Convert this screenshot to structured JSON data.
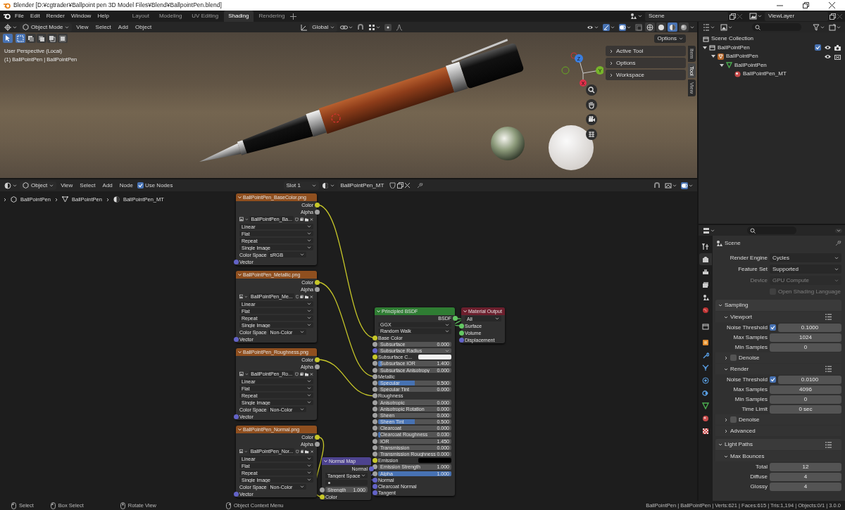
{
  "window": {
    "title": "Blender [D:¥cgtrader¥Ballpoint pen 3D Model Files¥Blend¥BallpointPen.blend]"
  },
  "menu": [
    "File",
    "Edit",
    "Render",
    "Window",
    "Help"
  ],
  "workspaces": [
    {
      "label": "Layout",
      "selected": false
    },
    {
      "label": "Modeling",
      "selected": false
    },
    {
      "label": "UV Editing",
      "selected": false
    },
    {
      "label": "Shading",
      "selected": true
    },
    {
      "label": "Rendering",
      "selected": false
    }
  ],
  "scene": "Scene",
  "view_layer": "ViewLayer",
  "viewport": {
    "mode": "Object Mode",
    "menu": [
      "View",
      "Select",
      "Add",
      "Object"
    ],
    "orientation": "Global",
    "select_modes": [
      {
        "selected": true
      },
      {
        "selected": false
      },
      {
        "selected": false
      },
      {
        "selected": false
      },
      {
        "selected": false
      }
    ],
    "shading_modes": [
      {
        "selected": false
      },
      {
        "selected": false
      },
      {
        "selected": true
      },
      {
        "selected": false
      }
    ],
    "options": "Options",
    "info": [
      "User Perspective (Local)",
      "(1) BallPointPen | BallPointPen"
    ],
    "gizmo_axes": [
      "Z",
      "Y",
      "X"
    ],
    "sidebar_panels": [
      {
        "label": "Active Tool",
        "expanded": false
      },
      {
        "label": "Options",
        "expanded": false
      },
      {
        "label": "Workspace",
        "expanded": false
      }
    ],
    "sidebar_tabs": [
      {
        "label": "Item",
        "selected": false
      },
      {
        "label": "Tool",
        "selected": true
      },
      {
        "label": "View",
        "selected": false
      }
    ]
  },
  "node_editor": {
    "object": "Object",
    "menu": [
      "View",
      "Select",
      "Add",
      "Node"
    ],
    "use_nodes": {
      "label": "Use Nodes",
      "checked": true
    },
    "slot": "Slot 1",
    "material": "BallPointPen_MT",
    "breadcrumbs": [
      "BallPointPen",
      "BallPointPen",
      "BallPointPen_MT"
    ],
    "nodes": [
      {
        "kind": "image",
        "title": "BallPointPen_BaseColor.png",
        "outputs": [
          {
            "label": "Color",
            "socket": {
              "color": "#c7c729"
            }
          },
          {
            "label": "Alpha",
            "socket": {
              "color": "#a1a1a1"
            }
          }
        ],
        "image": "BallPointPen_Ba...",
        "dropdowns": [
          "Linear",
          "Flat",
          "Repeat",
          "Single Image"
        ],
        "color_space": {
          "label": "Color Space",
          "value": "sRGB"
        },
        "inputs": [
          {
            "kind": "socket",
            "label": "Vector",
            "socket": {
              "color": "#6363c7"
            }
          }
        ]
      },
      {
        "kind": "image",
        "title": "BallPointPen_Metallic.png",
        "outputs": [
          {
            "label": "Color",
            "socket": {
              "color": "#c7c729"
            }
          },
          {
            "label": "Alpha",
            "socket": {
              "color": "#a1a1a1"
            }
          }
        ],
        "image": "BallPointPen_Me...",
        "dropdowns": [
          "Linear",
          "Flat",
          "Repeat",
          "Single Image"
        ],
        "color_space": {
          "label": "Color Space",
          "value": "Non-Color"
        },
        "inputs": [
          {
            "kind": "socket",
            "label": "Vector",
            "socket": {
              "color": "#6363c7"
            }
          }
        ]
      },
      {
        "kind": "image",
        "title": "BallPointPen_Roughness.png",
        "outputs": [
          {
            "label": "Color",
            "socket": {
              "color": "#c7c729"
            }
          },
          {
            "label": "Alpha",
            "socket": {
              "color": "#a1a1a1"
            }
          }
        ],
        "image": "BallPointPen_Ro...",
        "dropdowns": [
          "Linear",
          "Flat",
          "Repeat",
          "Single Image"
        ],
        "color_space": {
          "label": "Color Space",
          "value": "Non-Color"
        },
        "inputs": [
          {
            "kind": "socket",
            "label": "Vector",
            "socket": {
              "color": "#6363c7"
            }
          }
        ]
      },
      {
        "kind": "image",
        "title": "BallPointPen_Normal.png",
        "outputs": [
          {
            "label": "Color",
            "socket": {
              "color": "#c7c729"
            }
          },
          {
            "label": "Alpha",
            "socket": {
              "color": "#a1a1a1"
            }
          }
        ],
        "image": "BallPointPen_Nor...",
        "dropdowns": [
          "Linear",
          "Flat",
          "Repeat",
          "Single Image"
        ],
        "color_space": {
          "label": "Color Space",
          "value": "Non-Color"
        },
        "inputs": [
          {
            "kind": "socket",
            "label": "Vector",
            "socket": {
              "color": "#6363c7"
            }
          }
        ]
      },
      {
        "kind": "bsdf",
        "title": "Principled BSDF",
        "outputs": [
          {
            "label": "BSDF",
            "socket": {
              "color": "#63c763"
            }
          }
        ],
        "dropdowns": [
          "GGX",
          "Random Walk"
        ],
        "inputs": [
          {
            "kind": "socket",
            "label": "Base Color",
            "socket": {
              "color": "#c7c729"
            }
          },
          {
            "kind": "slider",
            "label": "Subsurface",
            "value": "0.000",
            "level": 0,
            "socket": {
              "color": "#a1a1a1"
            }
          },
          {
            "kind": "dropdown",
            "label": "Subsurface Radius",
            "socket": {
              "color": "#6363c7"
            }
          },
          {
            "kind": "swatch",
            "label": "Subsurface C...",
            "color": "#f2f2f2",
            "socket": {
              "color": "#c7c729"
            }
          },
          {
            "kind": "slider",
            "label": "Subsurface IOR",
            "value": "1.400",
            "level": 0.05,
            "socket": {
              "color": "#a1a1a1"
            }
          },
          {
            "kind": "slider",
            "label": "Subsurface Anisotropy",
            "value": "0.000",
            "level": 0,
            "socket": {
              "color": "#a1a1a1"
            }
          },
          {
            "kind": "socket",
            "label": "Metallic",
            "socket": {
              "color": "#a1a1a1"
            }
          },
          {
            "kind": "slider",
            "label": "Specular",
            "value": "0.500",
            "level": 0.5,
            "socket": {
              "color": "#a1a1a1"
            }
          },
          {
            "kind": "slider",
            "label": "Specular Tint",
            "value": "0.000",
            "level": 0,
            "socket": {
              "color": "#a1a1a1"
            }
          },
          {
            "kind": "socket",
            "label": "Roughness",
            "socket": {
              "color": "#a1a1a1"
            }
          },
          {
            "kind": "slider",
            "label": "Anisotropic",
            "value": "0.000",
            "level": 0,
            "socket": {
              "color": "#a1a1a1"
            }
          },
          {
            "kind": "slider",
            "label": "Anisotropic Rotation",
            "value": "0.000",
            "level": 0,
            "socket": {
              "color": "#a1a1a1"
            }
          },
          {
            "kind": "slider",
            "label": "Sheen",
            "value": "0.000",
            "level": 0,
            "socket": {
              "color": "#a1a1a1"
            }
          },
          {
            "kind": "slider",
            "label": "Sheen Tint",
            "value": "0.500",
            "level": 0.5,
            "socket": {
              "color": "#a1a1a1"
            }
          },
          {
            "kind": "slider",
            "label": "Clearcoat",
            "value": "0.000",
            "level": 0,
            "socket": {
              "color": "#a1a1a1"
            }
          },
          {
            "kind": "slider",
            "label": "Clearcoat Roughness",
            "value": "0.030",
            "level": 0.03,
            "socket": {
              "color": "#a1a1a1"
            }
          },
          {
            "kind": "number",
            "label": "IOR",
            "value": "1.450",
            "socket": {
              "color": "#a1a1a1"
            }
          },
          {
            "kind": "slider",
            "label": "Transmission",
            "value": "0.000",
            "level": 0,
            "socket": {
              "color": "#a1a1a1"
            }
          },
          {
            "kind": "slider",
            "label": "Transmission Roughness",
            "value": "0.000",
            "level": 0,
            "socket": {
              "color": "#a1a1a1"
            }
          },
          {
            "kind": "swatch",
            "label": "Emission",
            "color": "#000000",
            "socket": {
              "color": "#c7c729"
            }
          },
          {
            "kind": "number",
            "label": "Emission Strength",
            "value": "1.000",
            "socket": {
              "color": "#a1a1a1"
            }
          },
          {
            "kind": "slider",
            "label": "Alpha",
            "value": "1.000",
            "level": 1,
            "socket": {
              "color": "#a1a1a1"
            }
          },
          {
            "kind": "socket",
            "label": "Normal",
            "socket": {
              "color": "#6363c7"
            }
          },
          {
            "kind": "socket",
            "label": "Clearcoat Normal",
            "socket": {
              "color": "#6363c7"
            }
          },
          {
            "kind": "socket",
            "label": "Tangent",
            "socket": {
              "color": "#6363c7"
            }
          }
        ]
      },
      {
        "kind": "output",
        "title": "Material Output",
        "dropdowns": [
          "All"
        ],
        "inputs": [
          {
            "kind": "socket",
            "label": "Surface",
            "socket": {
              "color": "#63c763"
            }
          },
          {
            "kind": "socket",
            "label": "Volume",
            "socket": {
              "color": "#63c763"
            }
          },
          {
            "kind": "socket",
            "label": "Displacement",
            "socket": {
              "color": "#6363c7"
            }
          }
        ]
      },
      {
        "kind": "normal",
        "title": "Normal Map",
        "outputs": [
          {
            "label": "Normal",
            "socket": {
              "color": "#6363c7"
            }
          }
        ],
        "dropdowns": [
          "Tangent Space"
        ],
        "inputs": [
          {
            "kind": "number",
            "label": "Strength",
            "value": "1.000",
            "socket": {
              "color": "#a1a1a1"
            }
          },
          {
            "kind": "socket",
            "label": "Color",
            "socket": {
              "color": "#c7c729"
            }
          }
        ]
      }
    ],
    "links_drawn": true
  },
  "outliner": {
    "root": {
      "label": "Scene Collection",
      "children": [
        {
          "label": "BallPointPen",
          "kind": "collection",
          "expanded": true,
          "checked": true,
          "children": [
            {
              "label": "BallPointPen",
              "kind": "object",
              "expanded": true,
              "children": [
                {
                  "label": "BallPointPen",
                  "kind": "mesh",
                  "expanded": true,
                  "children": [
                    {
                      "label": "BallPointPen_MT",
                      "kind": "material"
                    }
                  ]
                }
              ]
            }
          ]
        }
      ]
    }
  },
  "properties": {
    "title": "Scene",
    "tabs": [
      {
        "selected": false
      },
      {
        "selected": true
      },
      {
        "selected": false
      },
      {
        "selected": false
      },
      {
        "selected": false
      },
      {
        "selected": false
      },
      {
        "selected": false
      },
      {
        "selected": false
      },
      {
        "selected": false
      },
      {
        "selected": false
      },
      {
        "selected": false
      },
      {
        "selected": false
      },
      {
        "selected": false
      },
      {
        "selected": false
      },
      {
        "selected": false
      }
    ],
    "rows": [
      {
        "kind": "dropdown",
        "label": "Render Engine",
        "value": "Cycles",
        "disabled": false
      },
      {
        "kind": "dropdown",
        "label": "Feature Set",
        "value": "Supported",
        "disabled": false
      },
      {
        "kind": "dropdown",
        "label": "Device",
        "value": "GPU Compute",
        "disabled": true
      },
      {
        "kind": "checkbox",
        "label": "Open Shading Language",
        "checked": false,
        "disabled": true
      },
      {
        "kind": "panel",
        "label": "Sampling",
        "expanded": true,
        "presets": false
      },
      {
        "kind": "subpanel",
        "label": "Viewport",
        "expanded": true,
        "presets": true
      },
      {
        "kind": "check_number",
        "label": "Noise Threshold",
        "checked": true,
        "value": "0.1000",
        "disabled": false
      },
      {
        "kind": "number",
        "label": "Max Samples",
        "value": "1024",
        "disabled": false
      },
      {
        "kind": "number",
        "label": "Min Samples",
        "value": "0",
        "disabled": false
      },
      {
        "kind": "subpanel_check",
        "label": "Denoise",
        "expanded": false,
        "checked": false
      },
      {
        "kind": "subpanel",
        "label": "Render",
        "expanded": true,
        "presets": true
      },
      {
        "kind": "check_number",
        "label": "Noise Threshold",
        "checked": true,
        "value": "0.0100",
        "disabled": false
      },
      {
        "kind": "number",
        "label": "Max Samples",
        "value": "4096",
        "disabled": false
      },
      {
        "kind": "number",
        "label": "Min Samples",
        "value": "0",
        "disabled": false
      },
      {
        "kind": "number",
        "label": "Time Limit",
        "value": "0 sec",
        "disabled": false
      },
      {
        "kind": "subpanel_check",
        "label": "Denoise",
        "expanded": false,
        "checked": false
      },
      {
        "kind": "subpanel",
        "label": "Advanced",
        "expanded": false,
        "presets": false
      },
      {
        "kind": "panel",
        "label": "Light Paths",
        "expanded": true,
        "presets": true
      },
      {
        "kind": "subpanel",
        "label": "Max Bounces",
        "expanded": true,
        "presets": false
      },
      {
        "kind": "number",
        "label": "Total",
        "value": "12",
        "disabled": false
      },
      {
        "kind": "number",
        "label": "Diffuse",
        "value": "4",
        "disabled": false
      },
      {
        "kind": "number",
        "label": "Glossy",
        "value": "4",
        "disabled": false
      }
    ]
  },
  "status_bar": {
    "hints": [
      "Select",
      "Box Select",
      "Rotate View",
      "Object Context Menu"
    ],
    "stats": "BallPointPen | BallPointPen | Verts:621 | Faces:615 | Tris:1,194 | Objects:0/1 | 3.0.0"
  }
}
